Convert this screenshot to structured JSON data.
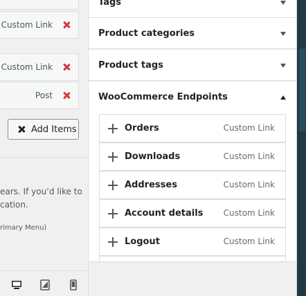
{
  "left_panel": {
    "menu_items": [
      {
        "type": "Custom Link"
      },
      {
        "type": "Custom Link"
      },
      {
        "type": "Post"
      }
    ],
    "add_items_label": "Add Items",
    "description_line1": "ears. If you’d like to",
    "description_line2": "cation.",
    "location_text": "rimary Menu)",
    "device_icons": [
      "desktop-icon",
      "tablet-icon",
      "mobile-icon"
    ]
  },
  "right_panel": {
    "sections": [
      {
        "title": "Tags",
        "expanded": false
      },
      {
        "title": "Product categories",
        "expanded": false
      },
      {
        "title": "Product tags",
        "expanded": false
      },
      {
        "title": "WooCommerce Endpoints",
        "expanded": true
      }
    ],
    "woocommerce_endpoints": [
      {
        "name": "Orders",
        "type": "Custom Link"
      },
      {
        "name": "Downloads",
        "type": "Custom Link"
      },
      {
        "name": "Addresses",
        "type": "Custom Link"
      },
      {
        "name": "Account details",
        "type": "Custom Link"
      },
      {
        "name": "Logout",
        "type": "Custom Link"
      }
    ]
  },
  "colors": {
    "remove_red": "#d63638",
    "panel_bg": "#f0f0f1",
    "border": "#dcdcde",
    "preview_bg": "#1e3a46"
  }
}
